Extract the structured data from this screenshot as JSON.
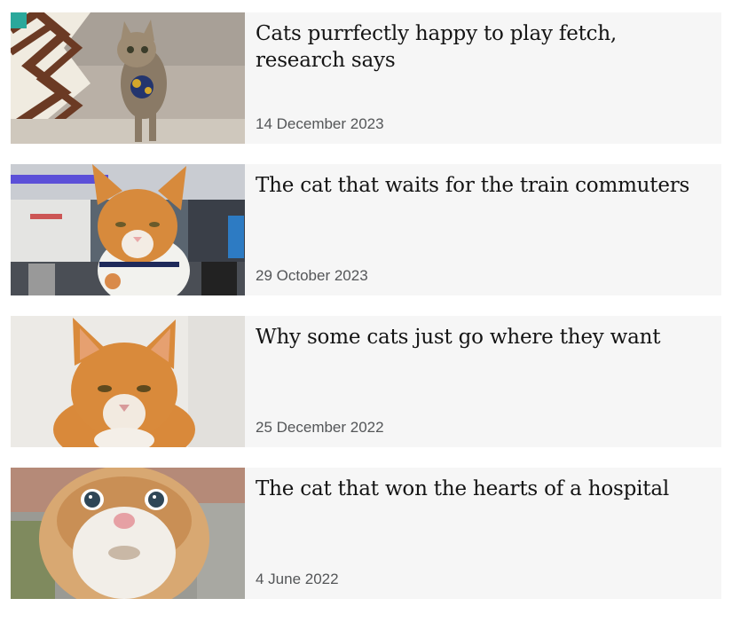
{
  "articles": [
    {
      "headline": "Cats purrfectly happy to play fetch, research says",
      "date": "14 December 2023",
      "image_alt": "tabby kitten carrying a blue and gold pom-pom toy"
    },
    {
      "headline": "The cat that waits for the train commuters",
      "date": "29 October 2023",
      "image_alt": "ginger cat at railway station ticket barriers"
    },
    {
      "headline": "Why some cats just go where they want",
      "date": "25 December 2022",
      "image_alt": "ginger and white cat"
    },
    {
      "headline": "The cat that won the hearts of a hospital",
      "date": "4 June 2022",
      "image_alt": "close-up of a ginger and white cat face"
    }
  ]
}
